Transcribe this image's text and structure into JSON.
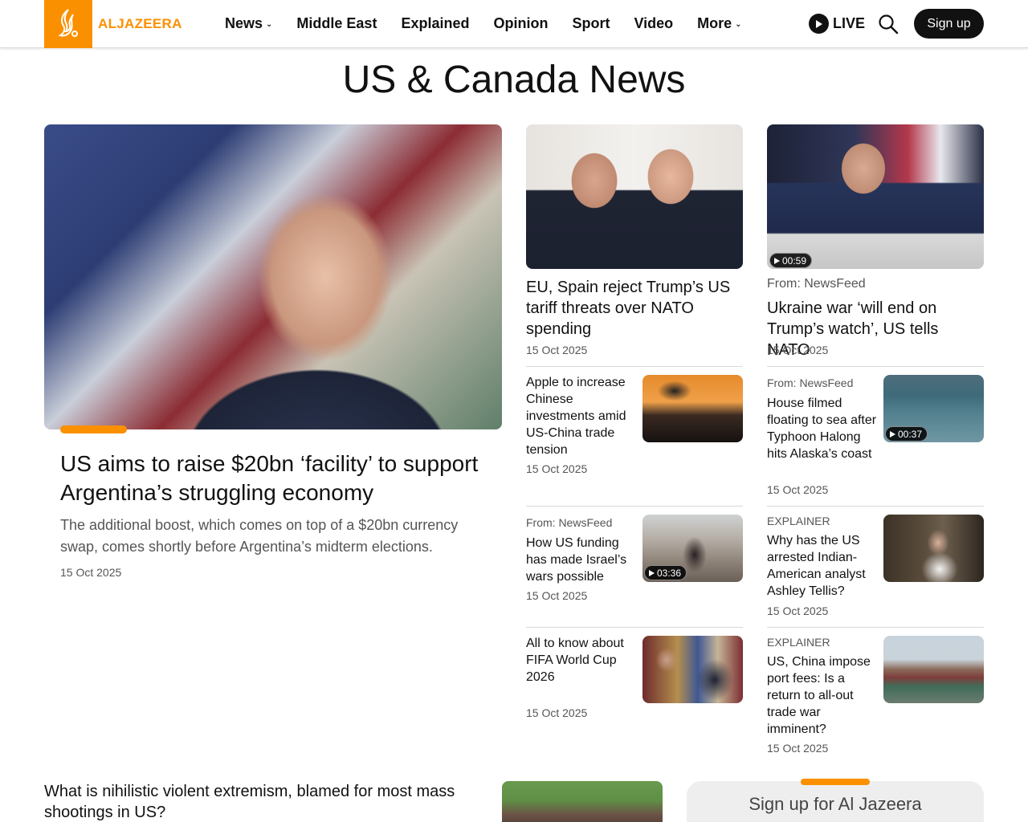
{
  "header": {
    "logo_text": "ALJAZEERA",
    "nav": [
      {
        "label": "News",
        "has_dropdown": true
      },
      {
        "label": "Middle East",
        "has_dropdown": false
      },
      {
        "label": "Explained",
        "has_dropdown": false
      },
      {
        "label": "Opinion",
        "has_dropdown": false
      },
      {
        "label": "Sport",
        "has_dropdown": false
      },
      {
        "label": "Video",
        "has_dropdown": false
      },
      {
        "label": "More",
        "has_dropdown": true
      }
    ],
    "live_label": "LIVE",
    "signup_label": "Sign up",
    "accent_color": "#fa9000"
  },
  "page_title": "US & Canada News",
  "hero": {
    "title": "US aims to raise $20bn ‘facility’ to support Argentina’s struggling economy",
    "summary": "The additional boost, which comes on top of a $20bn currency swap, comes shortly before Argentina’s midterm elections.",
    "date": "15 Oct 2025"
  },
  "cards": [
    {
      "title": "EU, Spain reject Trump’s US tariff threats over NATO spending",
      "date": "15 Oct 2025"
    },
    {
      "source": "From: NewsFeed",
      "title": "Ukraine war ‘will end on Trump’s watch’, US tells NATO",
      "date": "15 Oct 2025",
      "video_duration": "00:59"
    }
  ],
  "small_cards": [
    {
      "title": "Apple to increase Chinese investments amid US-China trade tension",
      "date": "15 Oct 2025"
    },
    {
      "source": "From: NewsFeed",
      "title": "House filmed floating to sea after Typhoon Halong hits Alaska’s coast",
      "date": "15 Oct 2025",
      "video_duration": "00:37"
    },
    {
      "source": "From: NewsFeed",
      "title": "How US funding has made Israel’s wars possible",
      "date": "15 Oct 2025",
      "video_duration": "03:36"
    },
    {
      "source": "EXPLAINER",
      "title": "Why has the US arrested Indian-American analyst Ashley Tellis?",
      "date": "15 Oct 2025"
    },
    {
      "title": "All to know about FIFA World Cup 2026",
      "date": "15 Oct 2025"
    },
    {
      "source": "EXPLAINER",
      "title": "US, China impose port fees: Is a return to all-out trade war imminent?",
      "date": "15 Oct 2025"
    }
  ],
  "bottom": {
    "headline": "What is nihilistic violent extremism, blamed for most mass shootings in US?",
    "newsletter_title": "Sign up for Al Jazeera"
  }
}
